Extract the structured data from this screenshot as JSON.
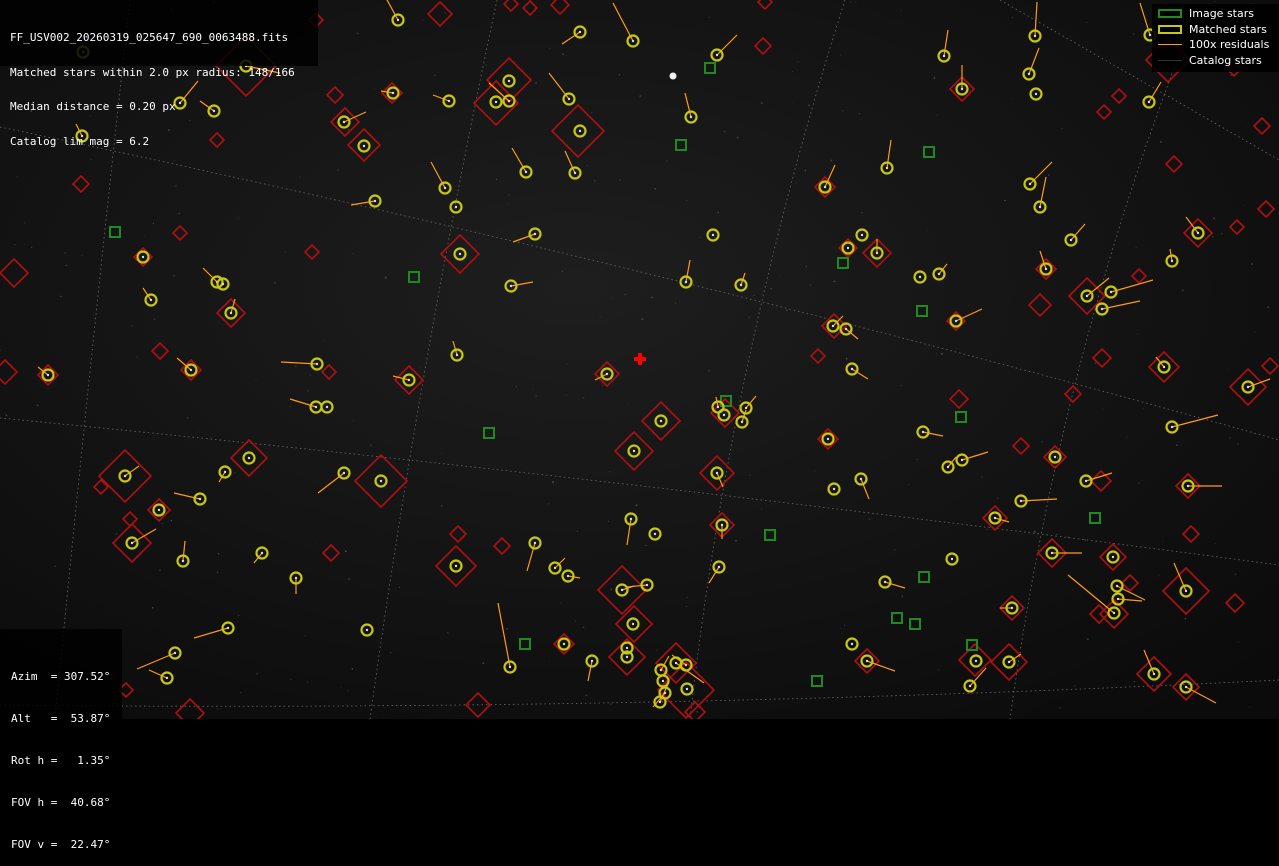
{
  "info": {
    "filename": "FF_USV002_20260319_025647_690_0063488.fits",
    "matched": "Matched stars within 2.0 px radius: 148/166",
    "median": "Median distance = 0.20 px",
    "catalog": "Catalog lim mag = 6.2"
  },
  "legend": {
    "image_stars": "Image stars",
    "matched_stars": "Matched stars",
    "residuals": "100x residuals",
    "catalog_stars": "Catalog stars"
  },
  "angles": {
    "azim": "Azim  = 307.52°",
    "alt": "Alt   =  53.87°",
    "rot": "Rot h =   1.35°",
    "fov_h": "FOV h =  40.68°",
    "fov_v": "FOV v =  22.47°"
  },
  "colors": {
    "image_star": "#1f8a1f",
    "matched_star": "#c8c814",
    "residual": "#ff9a1a",
    "catalog_star": "#b01010",
    "center_mark": "#ff0000",
    "grid": "#777777"
  }
}
